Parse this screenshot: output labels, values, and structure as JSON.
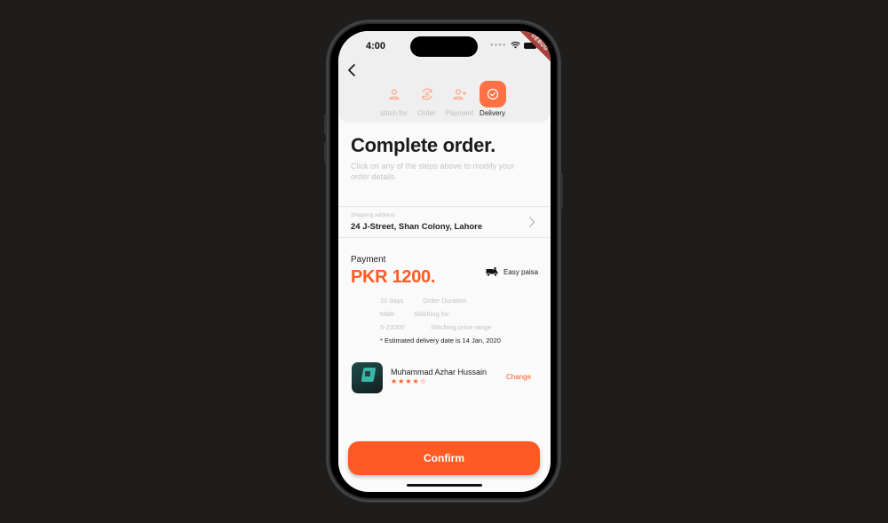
{
  "status_bar": {
    "time": "4:00",
    "debug_label": "DEBUG"
  },
  "header": {
    "back_icon": "chevron-left-icon",
    "steps": [
      {
        "label": "stitch for",
        "icon": "user-icon",
        "active": false
      },
      {
        "label": "Order",
        "icon": "dollar-refresh-icon",
        "active": false
      },
      {
        "label": "Payment",
        "icon": "user-plus-icon",
        "active": false
      },
      {
        "label": "Delivery",
        "icon": "check-circle-icon",
        "active": true
      }
    ]
  },
  "main": {
    "title": "Complete order.",
    "subtitle": "Click on any of the steps above to modify your order details."
  },
  "shipping": {
    "label": "Shipping address",
    "value": "24 J-Street, Shan Colony, Lahore"
  },
  "payment": {
    "label": "Payment",
    "price": "PKR 1200.",
    "method": "Easy paisa",
    "method_icon": "truck-icon",
    "details": [
      {
        "value": "10 days",
        "label": "Order Duration"
      },
      {
        "value": "Male",
        "label": "Stitching for"
      },
      {
        "value": "5-22000",
        "label": "Stitching price range"
      }
    ],
    "estimate": "* Estimated delivery date is 14 Jan, 2020"
  },
  "tailor": {
    "name": "Muhammad Azhar Hussain",
    "rating": 4,
    "rating_max": 5,
    "stars_text": "★★★★☆",
    "change_label": "Change"
  },
  "actions": {
    "confirm_label": "Confirm"
  },
  "colors": {
    "accent": "#ff5a24",
    "step_active": "#ff7145",
    "step_inactive": "#ffb9a3"
  }
}
